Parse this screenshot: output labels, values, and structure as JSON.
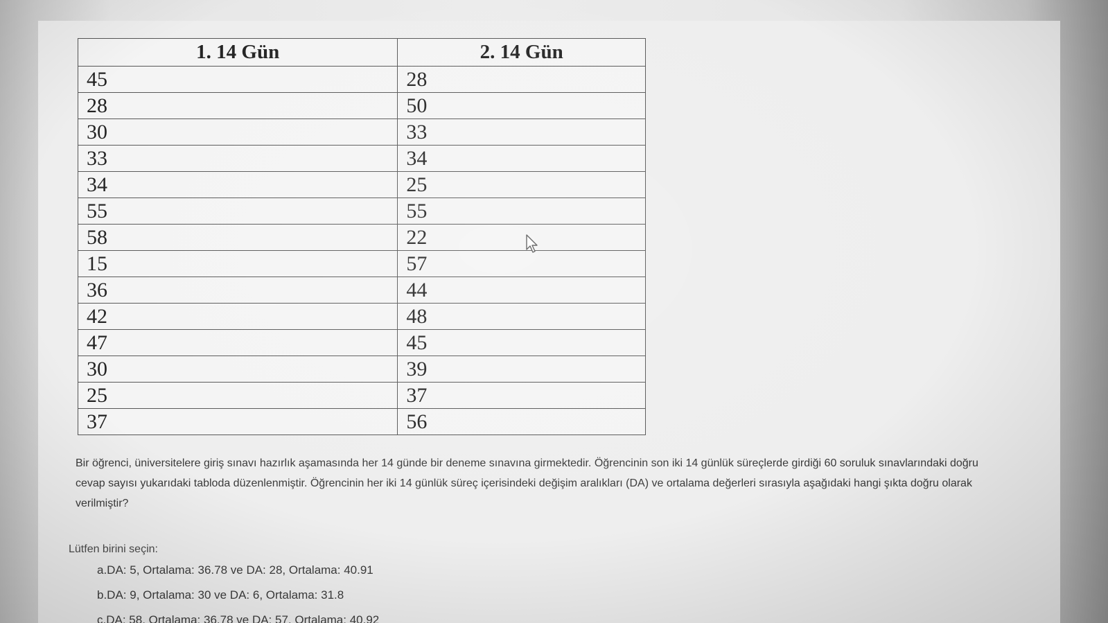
{
  "table": {
    "headers": [
      "1. 14 Gün",
      "2. 14 Gün"
    ],
    "rows": [
      [
        "45",
        "28"
      ],
      [
        "28",
        "50"
      ],
      [
        "30",
        "33"
      ],
      [
        "33",
        "34"
      ],
      [
        "34",
        "25"
      ],
      [
        "55",
        "55"
      ],
      [
        "58",
        "22"
      ],
      [
        "15",
        "57"
      ],
      [
        "36",
        "44"
      ],
      [
        "42",
        "48"
      ],
      [
        "47",
        "45"
      ],
      [
        "30",
        "39"
      ],
      [
        "25",
        "37"
      ],
      [
        "37",
        "56"
      ]
    ]
  },
  "question": {
    "text": "Bir öğrenci, üniversitelere giriş sınavı hazırlık aşamasında her 14 günde bir deneme sınavına girmektedir. Öğrencinin son iki 14 günlük süreçlerde girdiği 60 soruluk sınavlarındaki doğru cevap sayısı yukarıdaki tabloda düzenlenmiştir. Öğrencinin her iki 14 günlük süreç içerisindeki değişim aralıkları (DA) ve ortalama değerleri sırasıyla aşağıdaki hangi şıkta doğru olarak verilmiştir?"
  },
  "answers": {
    "prompt": "Lütfen birini seçin:",
    "options": [
      "a.DA: 5, Ortalama: 36.78 ve DA: 28, Ortalama: 40.91",
      "b.DA: 9, Ortalama: 30 ve DA: 6, Ortalama: 31.8",
      "c.DA: 58, Ortalama: 36.78 ve DA: 57, Ortalama: 40.92"
    ]
  },
  "icons": {
    "cursor": "mouse-pointer-icon"
  }
}
